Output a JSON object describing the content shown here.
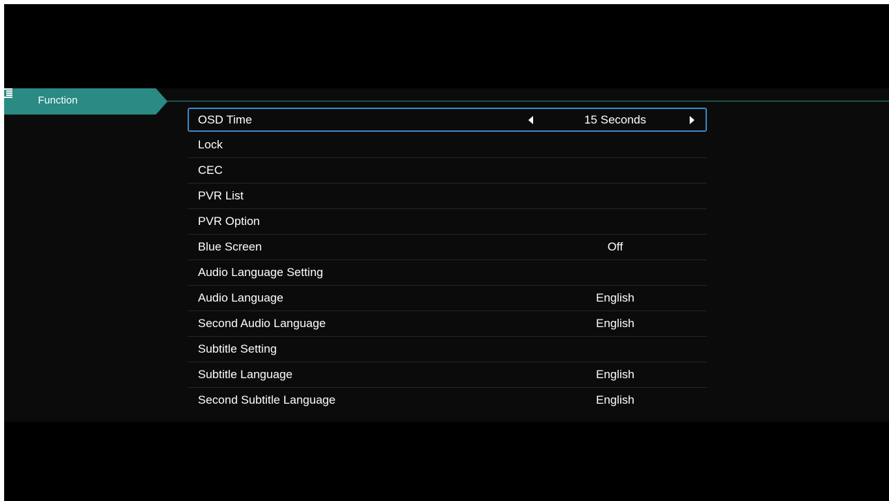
{
  "header": {
    "tab_label": "Function",
    "tab_icon": "menu-list-icon",
    "accent_color": "#2a8a84"
  },
  "menu": {
    "selection_color": "#3d86c6",
    "items": [
      {
        "label": "OSD Time",
        "value": "15 Seconds",
        "selected": true
      },
      {
        "label": "Lock",
        "value": ""
      },
      {
        "label": "CEC",
        "value": ""
      },
      {
        "label": "PVR List",
        "value": ""
      },
      {
        "label": "PVR Option",
        "value": ""
      },
      {
        "label": "Blue Screen",
        "value": "Off"
      },
      {
        "label": "Audio Language Setting",
        "value": ""
      },
      {
        "label": "Audio Language",
        "value": "English"
      },
      {
        "label": "Second Audio Language",
        "value": "English"
      },
      {
        "label": "Subtitle Setting",
        "value": ""
      },
      {
        "label": "Subtitle Language",
        "value": "English"
      },
      {
        "label": "Second Subtitle Language",
        "value": "English"
      }
    ]
  }
}
